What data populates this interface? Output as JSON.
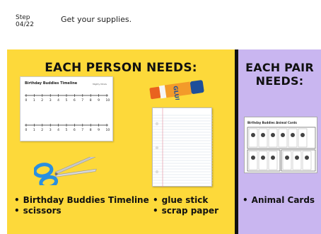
{
  "header": {
    "step_label": "Step",
    "step_number": "04/22",
    "instruction": "Get your supplies."
  },
  "person_panel": {
    "heading": "EACH PERSON NEEDS:",
    "timeline_sheet_title": "Birthday Buddies Timeline",
    "timeline_sheet_logo": "Mighty Minds",
    "timeline_ticks": [
      "0",
      "1",
      "2",
      "3",
      "4",
      "5",
      "6",
      "7",
      "8",
      "9",
      "10"
    ],
    "glue_label": "GLUE",
    "items_left": [
      "Birthday Buddies Timeline",
      "scissors"
    ],
    "items_right": [
      "glue stick",
      "scrap paper"
    ]
  },
  "pair_panel": {
    "heading": "EACH PAIR NEEDS:",
    "cards_title": "Birthday Buddies Animal Cards",
    "items": [
      "Animal Cards"
    ]
  },
  "colors": {
    "person_panel_bg": "#fdd93a",
    "pair_panel_bg": "#c9b6f0",
    "divider": "#111111",
    "scissors_blue": "#2a8fe0",
    "glue_orange": "#e9621f"
  },
  "icons": {
    "timeline": "timeline-worksheet-icon",
    "glue": "glue-stick-icon",
    "paper": "scrap-paper-icon",
    "scissors": "scissors-icon",
    "cards": "animal-cards-icon"
  }
}
